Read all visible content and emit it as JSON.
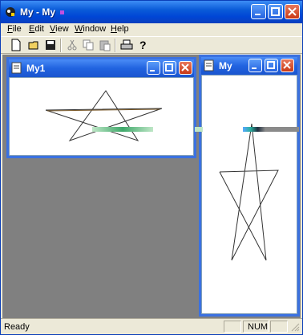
{
  "window": {
    "title": "My - My"
  },
  "menu": [
    "File",
    "Edit",
    "View",
    "Window",
    "Help"
  ],
  "toolbar": {
    "buttons": [
      "new-icon",
      "open-icon",
      "save-icon",
      "cut-icon",
      "copy-icon",
      "paste-icon",
      "print-icon",
      "help-icon"
    ]
  },
  "children": [
    {
      "title": "My1"
    },
    {
      "title": "My"
    }
  ],
  "status": {
    "text": "Ready",
    "num": "NUM"
  },
  "colors": {
    "titlebar": "#0a5bd8",
    "mdi_background": "#808080",
    "status_bar": "#ece9d8"
  }
}
